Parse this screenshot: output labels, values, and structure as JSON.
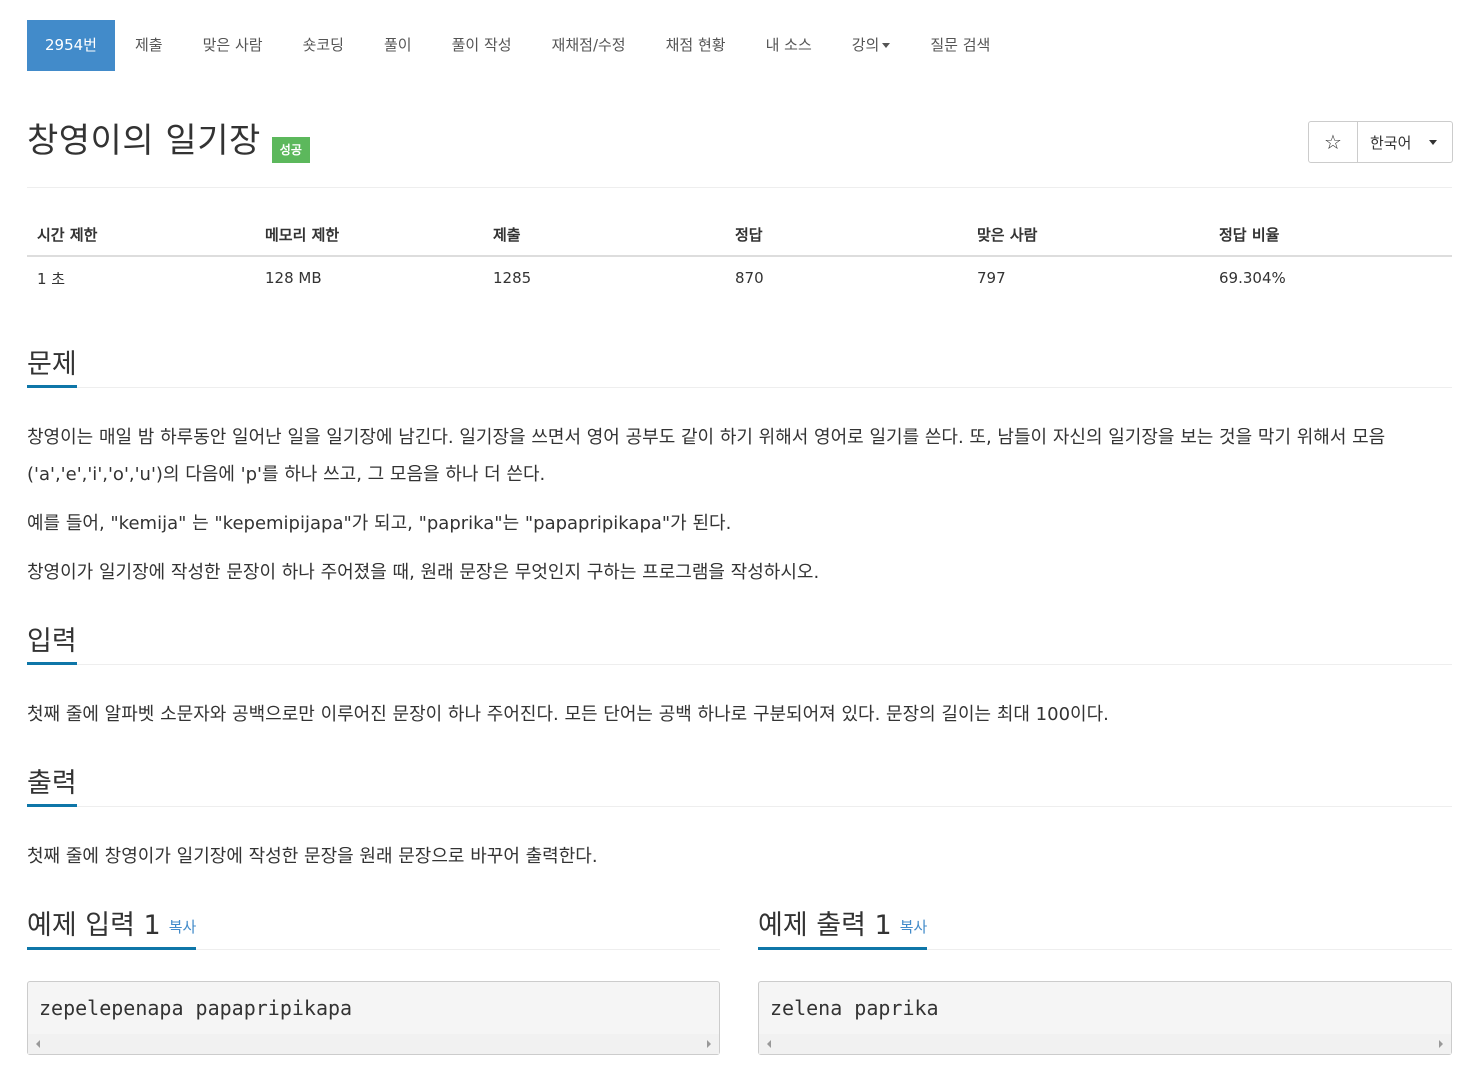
{
  "nav": {
    "items": [
      {
        "label": "2954번",
        "active": true
      },
      {
        "label": "제출"
      },
      {
        "label": "맞은 사람"
      },
      {
        "label": "숏코딩"
      },
      {
        "label": "풀이"
      },
      {
        "label": "풀이 작성"
      },
      {
        "label": "재채점/수정"
      },
      {
        "label": "채점 현황"
      },
      {
        "label": "내 소스"
      },
      {
        "label": "강의",
        "dropdown": true
      },
      {
        "label": "질문 검색"
      }
    ]
  },
  "problem": {
    "title": "창영이의 일기장",
    "badge": "성공",
    "badge_color": "#5cb85c",
    "star_icon": "star-outline-icon",
    "language": "한국어"
  },
  "info": {
    "headers": [
      "시간 제한",
      "메모리 제한",
      "제출",
      "정답",
      "맞은 사람",
      "정답 비율"
    ],
    "values": [
      "1 초",
      "128 MB",
      "1285",
      "870",
      "797",
      "69.304%"
    ]
  },
  "sections": {
    "problem": {
      "title": "문제",
      "paragraphs": [
        "창영이는 매일 밤 하루동안 일어난 일을 일기장에 남긴다. 일기장을 쓰면서 영어 공부도 같이 하기 위해서 영어로 일기를 쓴다. 또, 남들이 자신의 일기장을 보는 것을 막기 위해서 모음('a','e','i','o','u')의 다음에 'p'를 하나 쓰고,  그 모음을 하나 더 쓴다.",
        "예를 들어, \"kemija\" 는 \"kepemipijapa\"가 되고, \"paprika\"는 \"papapripikapa\"가 된다.",
        "창영이가 일기장에 작성한 문장이 하나 주어졌을 때, 원래 문장은 무엇인지 구하는 프로그램을 작성하시오."
      ]
    },
    "input": {
      "title": "입력",
      "text": "첫째 줄에 알파벳 소문자와 공백으로만 이루어진 문장이 하나 주어진다. 모든 단어는 공백 하나로 구분되어져 있다. 문장의 길이는 최대 100이다."
    },
    "output": {
      "title": "출력",
      "text": "첫째 줄에 창영이가 일기장에 작성한 문장을 원래 문장으로 바꾸어 출력한다."
    }
  },
  "samples": {
    "input": {
      "title": "예제 입력 1",
      "copy": "복사",
      "code": "zepelepenapa papapripikapa"
    },
    "output": {
      "title": "예제 출력 1",
      "copy": "복사",
      "code": "zelena paprika"
    }
  },
  "colors": {
    "accent": "#428bca",
    "underline": "#0e76a8",
    "success": "#5cb85c"
  }
}
